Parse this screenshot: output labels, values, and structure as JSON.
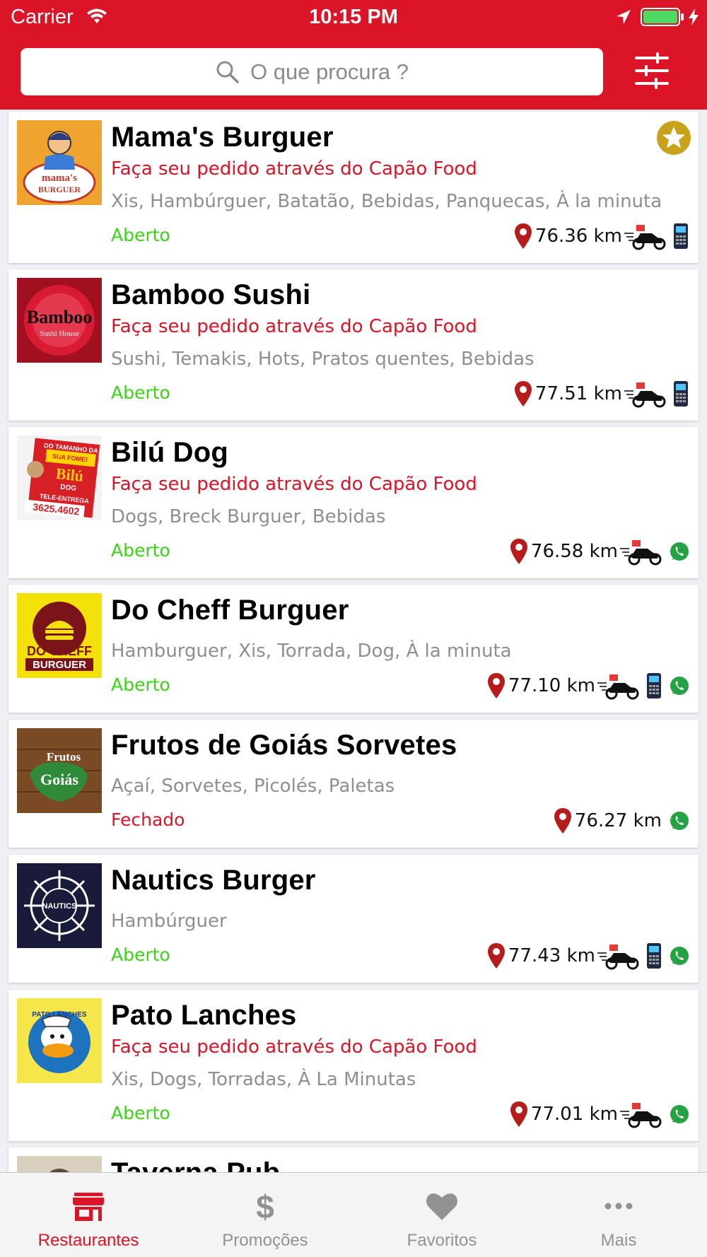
{
  "status_bar": {
    "carrier": "Carrier",
    "time": "10:15 PM"
  },
  "search": {
    "placeholder": "O que procura ?"
  },
  "colors": {
    "brand_red": "#dc1428",
    "open_green": "#3ad415",
    "closed_red": "#dc1428",
    "tag_gray": "#8e8e93"
  },
  "restaurants": [
    {
      "name": "Mama's Burguer",
      "promo": "Faça seu pedido através do Capão Food",
      "tags": "Xis, Hambúrguer, Batatão, Bebidas, Panquecas, À la minuta",
      "status": "Aberto",
      "distance": "76.36  km",
      "featured": true,
      "icons": [
        "location-pin-icon",
        "delivery-motorcycle-icon",
        "card-machine-icon"
      ]
    },
    {
      "name": "Bamboo Sushi",
      "promo": "Faça seu pedido através do Capão Food",
      "tags": "Sushi, Temakis, Hots, Pratos quentes, Bebidas",
      "status": "Aberto",
      "distance": "77.51  km",
      "icons": [
        "location-pin-icon",
        "delivery-motorcycle-icon",
        "card-machine-icon"
      ]
    },
    {
      "name": "Bilú Dog",
      "promo": "Faça seu pedido através do Capão Food",
      "tags": "Dogs, Breck Burguer, Bebidas",
      "status": "Aberto",
      "distance": "76.58  km",
      "icons": [
        "location-pin-icon",
        "delivery-motorcycle-icon",
        "whatsapp-icon"
      ]
    },
    {
      "name": "Do Cheff Burguer",
      "tags": "Hamburguer, Xis, Torrada, Dog, À la minuta",
      "status": "Aberto",
      "distance": "77.10  km",
      "icons": [
        "location-pin-icon",
        "delivery-motorcycle-icon",
        "card-machine-icon",
        "whatsapp-icon"
      ]
    },
    {
      "name": "Frutos de Goiás Sorvetes",
      "tags": "Açaí, Sorvetes, Picolés, Paletas",
      "status": "Fechado",
      "distance": "76.27  km",
      "icons": [
        "location-pin-icon",
        "whatsapp-icon"
      ]
    },
    {
      "name": "Nautics Burger",
      "tags": "Hambúrguer",
      "status": "Aberto",
      "distance": "77.43  km",
      "icons": [
        "location-pin-icon",
        "delivery-motorcycle-icon",
        "card-machine-icon",
        "whatsapp-icon"
      ]
    },
    {
      "name": "Pato Lanches",
      "promo": "Faça seu pedido através do Capão Food",
      "tags": "Xis, Dogs, Torradas, À La Minutas",
      "status": "Aberto",
      "distance": "77.01  km",
      "icons": [
        "location-pin-icon",
        "delivery-motorcycle-icon",
        "whatsapp-icon"
      ]
    },
    {
      "name": "Taverna Pub"
    }
  ],
  "logo_text": {
    "mamas": [
      "mama's",
      "BURGUER"
    ],
    "bamboo": [
      "Bamboo",
      "Sushi House"
    ],
    "bilu": [
      "DO TAMANHO DA",
      "SUA FOME!",
      "Bilú",
      "DOG",
      "TELE-ENTREGA",
      "3625.4602"
    ],
    "docheff": [
      "DO CHEFF",
      "BURGUER"
    ],
    "frutos": [
      "Frutos",
      "Goiás"
    ],
    "nautics": [
      "NAUTICS"
    ],
    "pato": [
      "PATO LANCHES"
    ]
  },
  "tabbar": {
    "tabs": [
      {
        "label": "Restaurantes",
        "icon": "store-icon",
        "active": true
      },
      {
        "label": "Promoções",
        "icon": "dollar-icon",
        "active": false
      },
      {
        "label": "Favoritos",
        "icon": "heart-icon",
        "active": false
      },
      {
        "label": "Mais",
        "icon": "more-dots-icon",
        "active": false
      }
    ]
  }
}
